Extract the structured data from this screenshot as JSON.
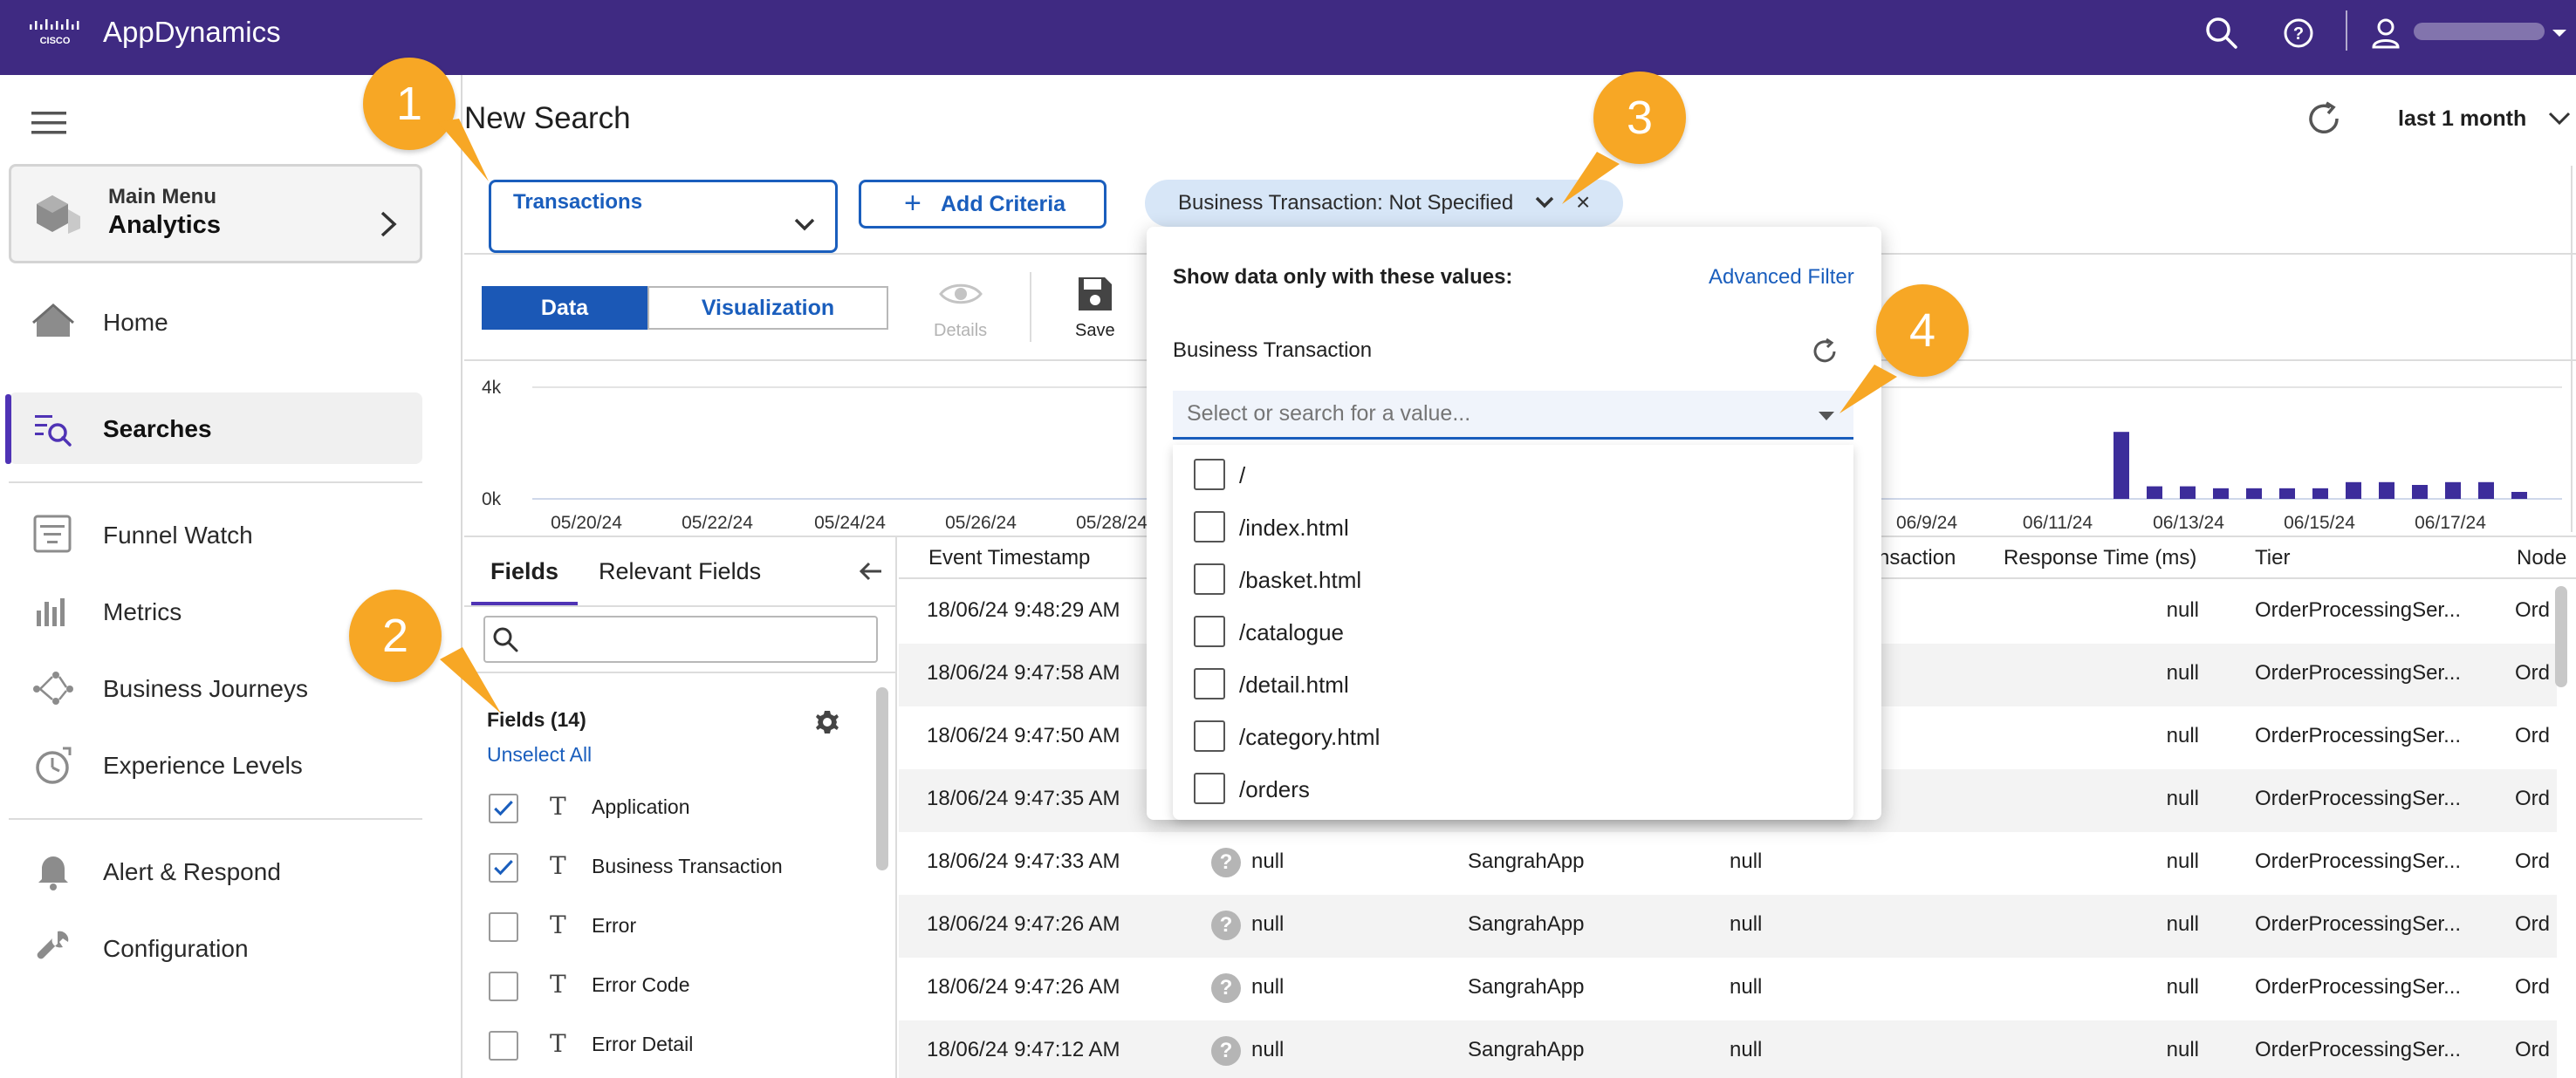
{
  "app": {
    "title": "AppDynamics",
    "brand_color": "#3f2a82",
    "accent_color": "#1a5ebd",
    "callout_color": "#f7a725"
  },
  "topbar": {
    "icons": [
      "search-icon",
      "help-icon",
      "user-icon",
      "chevron-down-icon"
    ]
  },
  "sidenav": {
    "main_menu": {
      "small": "Main Menu",
      "big": "Analytics"
    },
    "items": [
      {
        "label": "Home",
        "icon": "home-icon"
      },
      {
        "label": "Searches",
        "icon": "searches-icon",
        "active": true
      },
      {
        "label": "Funnel Watch",
        "icon": "funnel-watch-icon"
      },
      {
        "label": "Metrics",
        "icon": "metrics-icon"
      },
      {
        "label": "Business Journeys",
        "icon": "business-journeys-icon"
      },
      {
        "label": "Experience Levels",
        "icon": "experience-levels-icon"
      },
      {
        "label": "Alert & Respond",
        "icon": "bell-icon"
      },
      {
        "label": "Configuration",
        "icon": "wrench-icon"
      }
    ]
  },
  "header": {
    "title": "New Search",
    "time_range": "last 1 month"
  },
  "criteria": {
    "transactions_label": "Transactions",
    "add_criteria_label": "Add Criteria",
    "chip_label": "Business Transaction: Not Specified"
  },
  "toolbar": {
    "tab_data": "Data",
    "tab_visualization": "Visualization",
    "details_label": "Details",
    "save_label": "Save"
  },
  "chart_data": {
    "type": "bar",
    "y_ticks": [
      "4k",
      "0k"
    ],
    "x_ticks": [
      "05/20/24",
      "05/22/24",
      "05/24/24",
      "05/26/24",
      "05/28/24",
      "06/9/24",
      "06/11/24",
      "06/13/24",
      "06/15/24",
      "06/17/24"
    ],
    "ylim": [
      0,
      4000
    ],
    "series": [
      {
        "values": [
          2400,
          450,
          450,
          380,
          380,
          380,
          380,
          600,
          600,
          500,
          600,
          600,
          250
        ]
      }
    ]
  },
  "fields_panel": {
    "tab_fields": "Fields",
    "tab_relevant": "Relevant Fields",
    "count_label": "Fields (14)",
    "unselect_all": "Unselect All",
    "fields": [
      {
        "label": "Application",
        "checked": true
      },
      {
        "label": "Business Transaction",
        "checked": true
      },
      {
        "label": "Error",
        "checked": false
      },
      {
        "label": "Error Code",
        "checked": false
      },
      {
        "label": "Error Detail",
        "checked": false
      }
    ],
    "type_glyph": "T"
  },
  "table": {
    "headers": {
      "event_timestamp": "Event Timestamp",
      "transaction": "nsaction",
      "response_time": "Response Time (ms)",
      "tier": "Tier",
      "node": "Node"
    },
    "rows": [
      {
        "ts": "18/06/24 9:48:29 AM",
        "resp": "null",
        "tier": "OrderProcessingSer...",
        "node": "Ord"
      },
      {
        "ts": "18/06/24 9:47:58 AM",
        "resp": "null",
        "tier": "OrderProcessingSer...",
        "node": "Ord"
      },
      {
        "ts": "18/06/24 9:47:50 AM",
        "resp": "null",
        "tier": "OrderProcessingSer...",
        "node": "Ord"
      },
      {
        "ts": "18/06/24 9:47:35 AM",
        "resp": "null",
        "tier": "OrderProcessingSer...",
        "node": "Ord"
      },
      {
        "ts": "18/06/24 9:47:33 AM",
        "q": "?",
        "bt": "null",
        "app": "SangrahApp",
        "tx": "null",
        "resp": "null",
        "tier": "OrderProcessingSer...",
        "node": "Ord"
      },
      {
        "ts": "18/06/24 9:47:26 AM",
        "q": "?",
        "bt": "null",
        "app": "SangrahApp",
        "tx": "null",
        "resp": "null",
        "tier": "OrderProcessingSer...",
        "node": "Ord"
      },
      {
        "ts": "18/06/24 9:47:26 AM",
        "q": "?",
        "bt": "null",
        "app": "SangrahApp",
        "tx": "null",
        "resp": "null",
        "tier": "OrderProcessingSer...",
        "node": "Ord"
      },
      {
        "ts": "18/06/24 9:47:12 AM",
        "q": "?",
        "bt": "null",
        "app": "SangrahApp",
        "tx": "null",
        "resp": "null",
        "tier": "OrderProcessingSer...",
        "node": "Ord"
      }
    ]
  },
  "popover": {
    "title": "Show data only with these values:",
    "advanced_filter": "Advanced Filter",
    "field_label": "Business Transaction",
    "search_placeholder": "Select or search for a value...",
    "options": [
      "/",
      "/index.html",
      "/basket.html",
      "/catalogue",
      "/detail.html",
      "/category.html",
      "/orders"
    ]
  },
  "callouts": [
    "1",
    "2",
    "3",
    "4"
  ]
}
